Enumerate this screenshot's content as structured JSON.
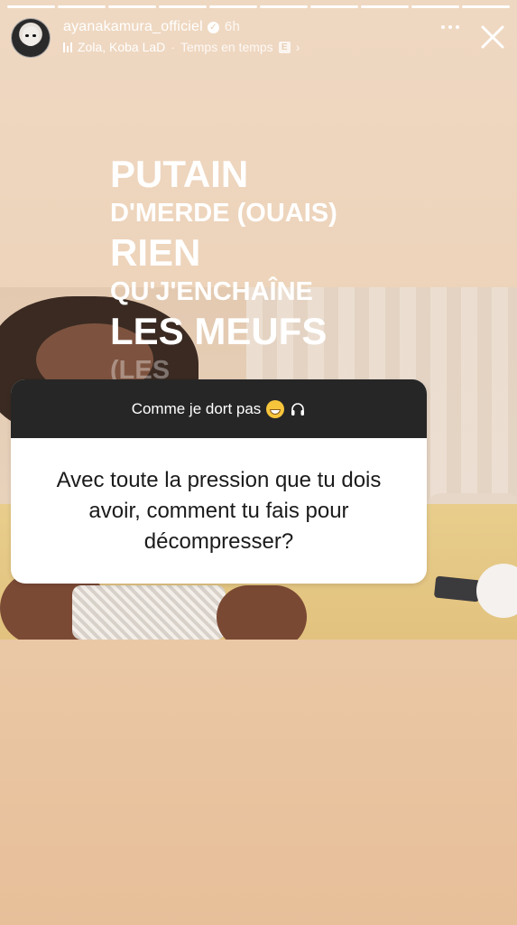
{
  "story": {
    "progress_segments": 10,
    "progress_completed": 10
  },
  "header": {
    "username": "ayanakamura_officiel",
    "verified": true,
    "time": "6h",
    "music_artists": "Zola, Koba LaD",
    "music_separator": "·",
    "music_song": "Temps en temps",
    "explicit_label": "E",
    "chevron": "›",
    "icons": [
      "avatar",
      "verified-icon",
      "music-bars-icon",
      "explicit-icon",
      "more-icon",
      "close-icon"
    ]
  },
  "lyrics": {
    "line1": "PUTAIN",
    "line2": "D'MERDE (OUAIS)",
    "line3": "RIEN",
    "line4": "QU'J'ENCHAÎNE",
    "line5": "LES MEUFS",
    "line6": "(LES"
  },
  "question_sticker": {
    "answer": "Comme je dort pas",
    "answer_icons": [
      "grinning-face-icon",
      "headphones-icon"
    ],
    "question": "Avec toute la pression que tu dois avoir, comment tu fais pour décompresser?"
  },
  "colors": {
    "background": "#ecd2b8",
    "sticker_header": "#262626",
    "sticker_body": "#ffffff",
    "text_light": "#ffffff",
    "text_dark": "#1b1b1b"
  }
}
